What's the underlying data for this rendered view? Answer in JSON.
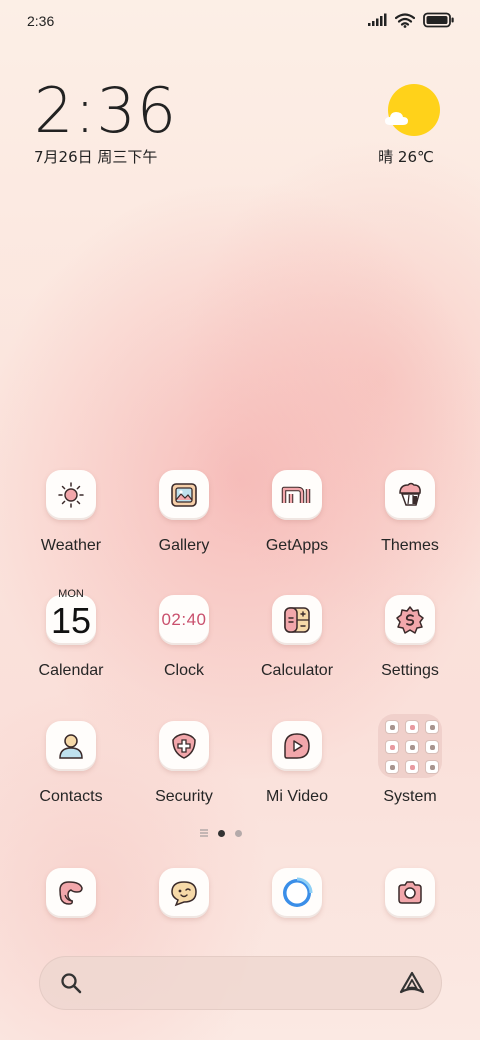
{
  "status_bar": {
    "time": "2:36",
    "battery_level": 1.0
  },
  "clock_widget": {
    "time": "2:36",
    "date": "7月26日 周三下午"
  },
  "weather_widget": {
    "condition": "晴",
    "temperature": "26℃",
    "icon": "sun-cloud-icon"
  },
  "apps": [
    {
      "label": "Weather",
      "icon": "weather-sun-icon"
    },
    {
      "label": "Gallery",
      "icon": "gallery-photo-icon"
    },
    {
      "label": "GetApps",
      "icon": "mi-store-icon"
    },
    {
      "label": "Themes",
      "icon": "themes-brush-icon"
    },
    {
      "label": "Calendar",
      "icon": "calendar-icon",
      "weekday": "MON",
      "day": "15"
    },
    {
      "label": "Clock",
      "icon": "clock-icon",
      "time": "02:40"
    },
    {
      "label": "Calculator",
      "icon": "calculator-icon"
    },
    {
      "label": "Settings",
      "icon": "settings-gear-icon"
    },
    {
      "label": "Contacts",
      "icon": "contact-person-icon"
    },
    {
      "label": "Security",
      "icon": "security-shield-icon"
    },
    {
      "label": "Mi Video",
      "icon": "video-play-icon"
    },
    {
      "label": "System",
      "icon": "system-folder-icon"
    }
  ],
  "page_indicator": {
    "pages": 2,
    "current": 1
  },
  "dock": [
    {
      "icon": "phone-icon"
    },
    {
      "icon": "messages-icon"
    },
    {
      "icon": "browser-icon"
    },
    {
      "icon": "camera-icon"
    }
  ],
  "search_bar": {
    "left_icon": "search-icon",
    "right_icon": "assistant-icon"
  },
  "colors": {
    "sun": "#ffd21a",
    "icon_pink": "#f2a7ab",
    "icon_outline": "#3a2a2a",
    "clock_text": "#c9506d"
  }
}
